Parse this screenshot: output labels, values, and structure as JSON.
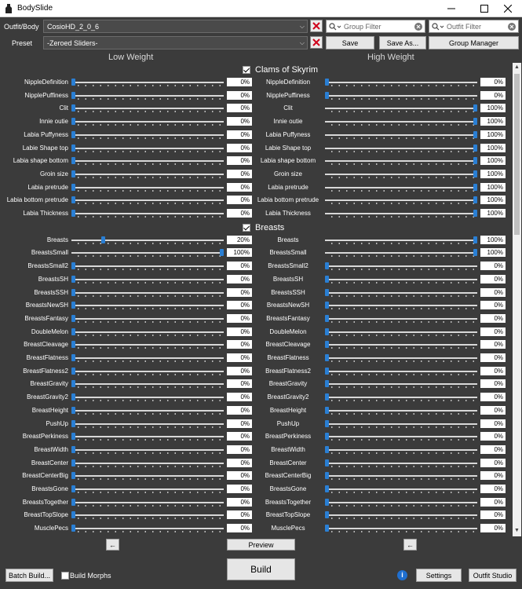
{
  "window": {
    "title": "BodySlide"
  },
  "toolbar": {
    "outfit_label": "Outfit/Body",
    "outfit_value": "CosioHD_2_0_6",
    "preset_label": "Preset",
    "preset_value": "-Zeroed Sliders-",
    "group_filter_placeholder": "Group Filter",
    "outfit_filter_placeholder": "Outfit Filter",
    "save_label": "Save",
    "save_as_label": "Save As...",
    "group_manager_label": "Group Manager"
  },
  "columns": {
    "low": "Low Weight",
    "high": "High Weight"
  },
  "groups": [
    {
      "title": "Clams of Skyrim",
      "checked": true,
      "sliders": [
        {
          "name": "NippleDefinition",
          "low": 0,
          "high": 0
        },
        {
          "name": "NipplePuffiness",
          "low": 0,
          "high": 0
        },
        {
          "name": "Clit",
          "low": 0,
          "high": 100
        },
        {
          "name": "Innie outie",
          "low": 0,
          "high": 100
        },
        {
          "name": "Labia Puffyness",
          "low": 0,
          "high": 100
        },
        {
          "name": "Labie Shape top",
          "low": 0,
          "high": 100
        },
        {
          "name": "Labia shape bottom",
          "low": 0,
          "high": 100
        },
        {
          "name": "Groin size",
          "low": 0,
          "high": 100
        },
        {
          "name": "Labia pretrude",
          "low": 0,
          "high": 100
        },
        {
          "name": "Labia bottom pretrude",
          "low": 0,
          "high": 100
        },
        {
          "name": "Labia Thickness",
          "low": 0,
          "high": 100
        }
      ]
    },
    {
      "title": "Breasts",
      "checked": true,
      "sliders": [
        {
          "name": "Breasts",
          "low": 20,
          "high": 100
        },
        {
          "name": "BreastsSmall",
          "low": 100,
          "high": 100
        },
        {
          "name": "BreastsSmall2",
          "low": 0,
          "high": 0
        },
        {
          "name": "BreastsSH",
          "low": 0,
          "high": 0
        },
        {
          "name": "BreastsSSH",
          "low": 0,
          "high": 0
        },
        {
          "name": "BreastsNewSH",
          "low": 0,
          "high": 0
        },
        {
          "name": "BreastsFantasy",
          "low": 0,
          "high": 0
        },
        {
          "name": "DoubleMelon",
          "low": 0,
          "high": 0
        },
        {
          "name": "BreastCleavage",
          "low": 0,
          "high": 0
        },
        {
          "name": "BreastFlatness",
          "low": 0,
          "high": 0
        },
        {
          "name": "BreastFlatness2",
          "low": 0,
          "high": 0
        },
        {
          "name": "BreastGravity",
          "low": 0,
          "high": 0
        },
        {
          "name": "BreastGravity2",
          "low": 0,
          "high": 0
        },
        {
          "name": "BreastHeight",
          "low": 0,
          "high": 0
        },
        {
          "name": "PushUp",
          "low": 0,
          "high": 0
        },
        {
          "name": "BreastPerkiness",
          "low": 0,
          "high": 0
        },
        {
          "name": "BreastWidth",
          "low": 0,
          "high": 0
        },
        {
          "name": "BreastCenter",
          "low": 0,
          "high": 0
        },
        {
          "name": "BreastCenterBig",
          "low": 0,
          "high": 0
        },
        {
          "name": "BreastsGone",
          "low": 0,
          "high": 0
        },
        {
          "name": "BreastsTogether",
          "low": 0,
          "high": 0
        },
        {
          "name": "BreastTopSlope",
          "low": 0,
          "high": 0
        },
        {
          "name": "MusclePecs",
          "low": 0,
          "high": 0
        }
      ]
    }
  ],
  "bottom": {
    "copy_left_label": "←",
    "preview_label": "Preview",
    "copy_right_label": "←",
    "batch_build_label": "Batch Build...",
    "build_morphs_label": "Build Morphs",
    "build_morphs_checked": false,
    "build_label": "Build",
    "info_label": "i",
    "settings_label": "Settings",
    "outfit_studio_label": "Outfit Studio"
  },
  "colors": {
    "accent": "#2a7fd4",
    "background": "#3b3b3b",
    "clear_x": "#d0021b"
  }
}
